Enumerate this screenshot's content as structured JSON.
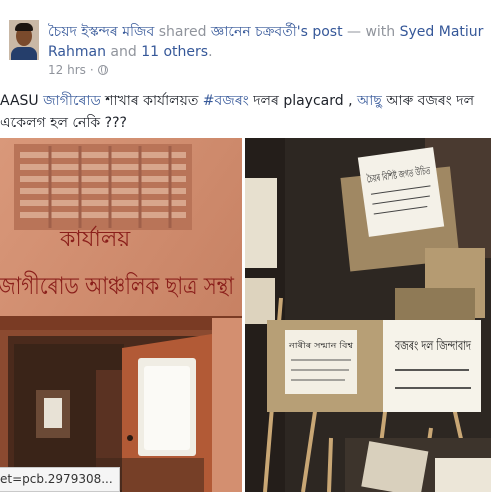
{
  "post": {
    "author": "চৈয়দ ইস্কন্দৰ মজিব",
    "shared_word": " shared ",
    "original_author": "জ্ঞানেন চক্ৰবৰ্তী",
    "post_suffix": "'s post",
    "with_word": " — with ",
    "tagged": "Syed Matiur Rahman",
    "and_word": " and ",
    "others": "11 others",
    "period": ".",
    "time": "12 hrs",
    "dot": "·",
    "text_parts": {
      "p1": "AASU ",
      "p2": "জাগীৰোড",
      "p3": " শাখাৰ কাৰ্যালয়ত ",
      "p4": "#বজৰং",
      "p5": " দলৰ playcard , ",
      "p6": "আছু",
      "p7": " আৰু বজৰং দল একেলগ হল নেকি ???"
    }
  },
  "photo_left": {
    "wall_sign_line1": "কাৰ্যালয়",
    "wall_sign_line2": "জাগীৰোড আঞ্চলিক ছাত্ৰ সন্থা"
  },
  "photo_right": {
    "placards": [
      "চৈয়ৰ বিশিষ্ট জগত উচিত",
      "নাৰীৰ সন্মান বিশ্ব",
      "বজৰং দল জিন্দাবাদ"
    ]
  },
  "status_url": "et=pcb.2979308..."
}
